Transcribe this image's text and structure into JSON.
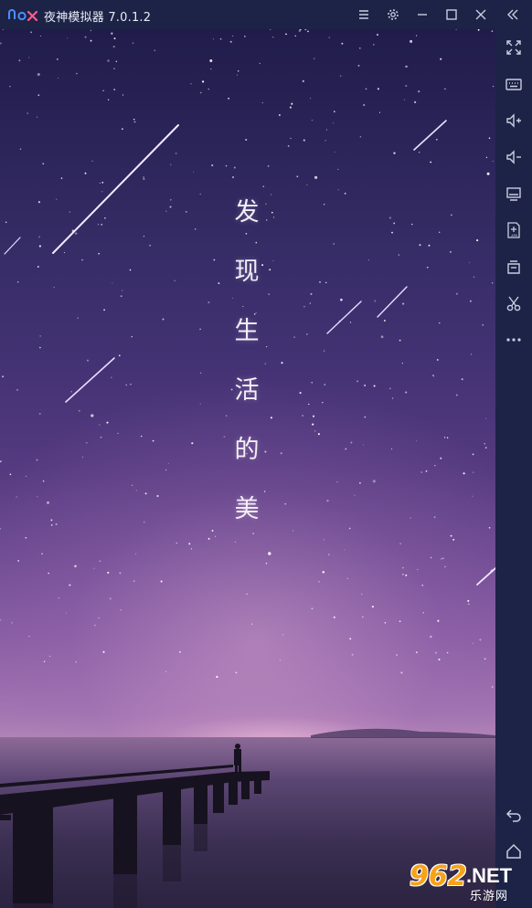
{
  "titlebar": {
    "logo_text": "nox",
    "title": "夜神模拟器 7.0.1.2",
    "buttons": [
      "menu-icon",
      "settings-icon",
      "minimize-icon",
      "maximize-icon",
      "close-icon",
      "collapse-sidebar-icon"
    ]
  },
  "screen": {
    "poem_chars": [
      "发",
      "现",
      "生",
      "活",
      "的",
      "美"
    ]
  },
  "sidebar": {
    "tools": [
      "fullscreen-icon",
      "keyboard-icon",
      "volume-up-icon",
      "volume-down-icon",
      "screen-icon",
      "apk-install-icon",
      "clean-icon",
      "scissors-icon",
      "more-icon"
    ],
    "bottom": [
      "back-icon",
      "home-icon"
    ]
  },
  "watermark": {
    "number": "962",
    "suffix": ".NET",
    "chinese": "乐游网"
  },
  "colors": {
    "chrome": "#1d2346",
    "accent": "#f7a21a",
    "logo_blue": "#4d8dff",
    "logo_pink": "#ff5a8a"
  }
}
